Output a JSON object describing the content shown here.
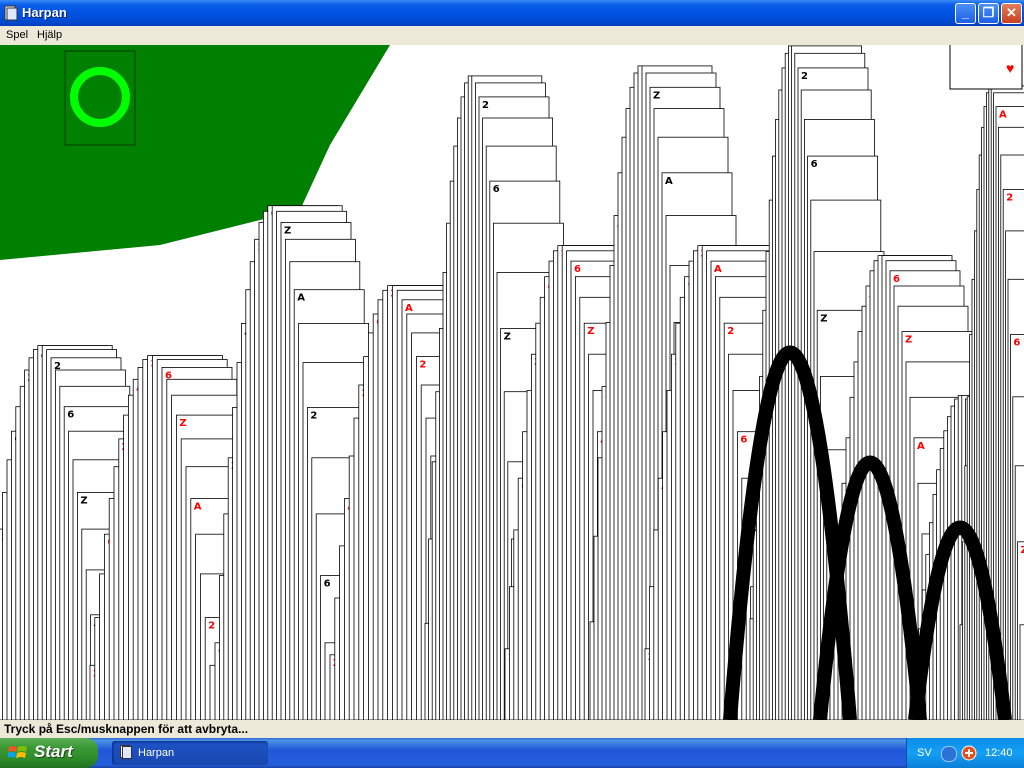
{
  "window": {
    "title": "Harpan"
  },
  "menu": {
    "items": [
      "Spel",
      "Hjälp"
    ]
  },
  "status": {
    "text": "Tryck på Esc/musknappen för att avbryta..."
  },
  "taskbar": {
    "start_label": "Start",
    "task_label": "Harpan",
    "language": "SV",
    "clock": "12:40"
  },
  "game": {
    "description_free": true,
    "card_glyphs": [
      "A",
      "2",
      "6",
      "Z"
    ],
    "colors": {
      "felt": "#008000",
      "ring": "#00ff00",
      "red": "#ff0000",
      "black": "#000000"
    }
  }
}
